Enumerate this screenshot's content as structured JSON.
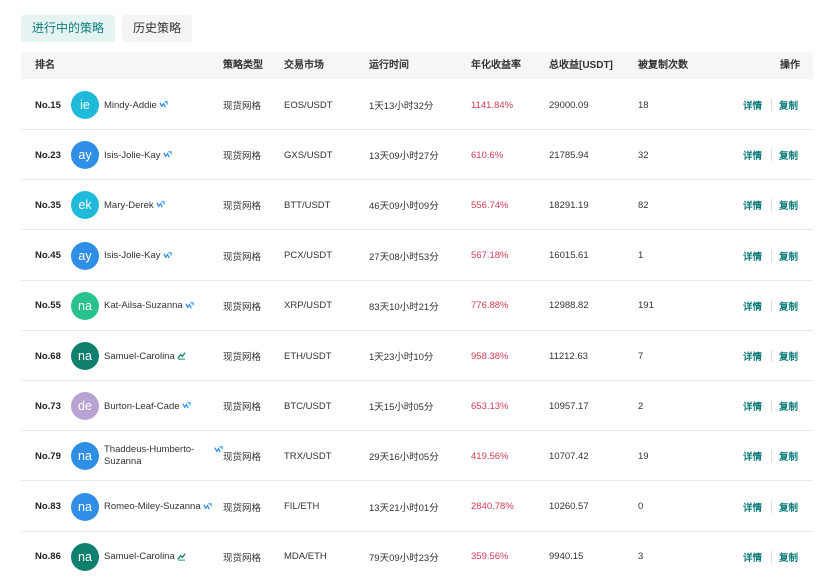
{
  "tabs": [
    {
      "label": "进行中的策略",
      "active": true
    },
    {
      "label": "历史策略",
      "active": false
    }
  ],
  "columns": {
    "rank": "排名",
    "type": "策略类型",
    "market": "交易市场",
    "time": "运行时间",
    "rate": "年化收益率",
    "profit": "总收益[USDT]",
    "copies": "被复制次数",
    "action": "操作"
  },
  "actions": {
    "detail": "详情",
    "copy": "复制"
  },
  "colors": {
    "accent": "#0e7c7b",
    "positive_rate": "#d23b53",
    "avatar_cyan": "#1fb9d9",
    "avatar_blue": "#2f8fe6",
    "avatar_green": "#27c28d",
    "avatar_teal": "#0f7f6e",
    "avatar_lavender": "#b9a3d3"
  },
  "rows": [
    {
      "rank": "No.15",
      "initials": "ie",
      "avatar_color": "#1fb9d9",
      "name": "Mindy-Addie",
      "badge_icon": "trend-badge-icon",
      "type": "现货网格",
      "market": "EOS/USDT",
      "time": "1天13小时32分",
      "rate": "1141.84%",
      "profit": "29000.09",
      "copies": "18"
    },
    {
      "rank": "No.23",
      "initials": "ay",
      "avatar_color": "#2f8fe6",
      "name": "Isis-Jolie-Kay",
      "badge_icon": "trend-badge-icon",
      "type": "现货网格",
      "market": "GXS/USDT",
      "time": "13天09小时27分",
      "rate": "610.6%",
      "profit": "21785.94",
      "copies": "32"
    },
    {
      "rank": "No.35",
      "initials": "ek",
      "avatar_color": "#1fb9d9",
      "name": "Mary-Derek",
      "badge_icon": "trend-badge-icon",
      "type": "现货网格",
      "market": "BTT/USDT",
      "time": "46天09小时09分",
      "rate": "556.74%",
      "profit": "18291.19",
      "copies": "82"
    },
    {
      "rank": "No.45",
      "initials": "ay",
      "avatar_color": "#2f8fe6",
      "name": "Isis-Jolie-Kay",
      "badge_icon": "trend-badge-icon",
      "type": "现货网格",
      "market": "PCX/USDT",
      "time": "27天08小时53分",
      "rate": "567.18%",
      "profit": "16015.61",
      "copies": "1"
    },
    {
      "rank": "No.55",
      "initials": "na",
      "avatar_color": "#27c28d",
      "name": "Kat-Ailsa-Suzanna",
      "badge_icon": "trend-badge-icon",
      "type": "现货网格",
      "market": "XRP/USDT",
      "time": "83天10小时21分",
      "rate": "776.88%",
      "profit": "12988.82",
      "copies": "191"
    },
    {
      "rank": "No.68",
      "initials": "na",
      "avatar_color": "#0f7f6e",
      "name": "Samuel-Carolina",
      "badge_icon": "chart-badge-icon",
      "type": "现货网格",
      "market": "ETH/USDT",
      "time": "1天23小时10分",
      "rate": "958.38%",
      "profit": "11212.63",
      "copies": "7"
    },
    {
      "rank": "No.73",
      "initials": "de",
      "avatar_color": "#b9a3d3",
      "name": "Burton-Leaf-Cade",
      "badge_icon": "trend-badge-icon",
      "type": "现货网格",
      "market": "BTC/USDT",
      "time": "1天15小时05分",
      "rate": "653.13%",
      "profit": "10957.17",
      "copies": "2"
    },
    {
      "rank": "No.79",
      "initials": "na",
      "avatar_color": "#2f8fe6",
      "name": "Thaddeus-Humberto-Suzanna",
      "badge_icon": "trend-badge-icon",
      "type": "现货网格",
      "market": "TRX/USDT",
      "time": "29天16小时05分",
      "rate": "419.56%",
      "profit": "10707.42",
      "copies": "19"
    },
    {
      "rank": "No.83",
      "initials": "na",
      "avatar_color": "#2f8fe6",
      "name": "Romeo-Miley-Suzanna",
      "badge_icon": "trend-badge-icon",
      "type": "现货网格",
      "market": "FIL/ETH",
      "time": "13天21小时01分",
      "rate": "2840.78%",
      "profit": "10260.57",
      "copies": "0"
    },
    {
      "rank": "No.86",
      "initials": "na",
      "avatar_color": "#0f7f6e",
      "name": "Samuel-Carolina",
      "badge_icon": "chart-badge-icon",
      "type": "现货网格",
      "market": "MDA/ETH",
      "time": "79天09小时23分",
      "rate": "359.56%",
      "profit": "9940.15",
      "copies": "3"
    }
  ]
}
